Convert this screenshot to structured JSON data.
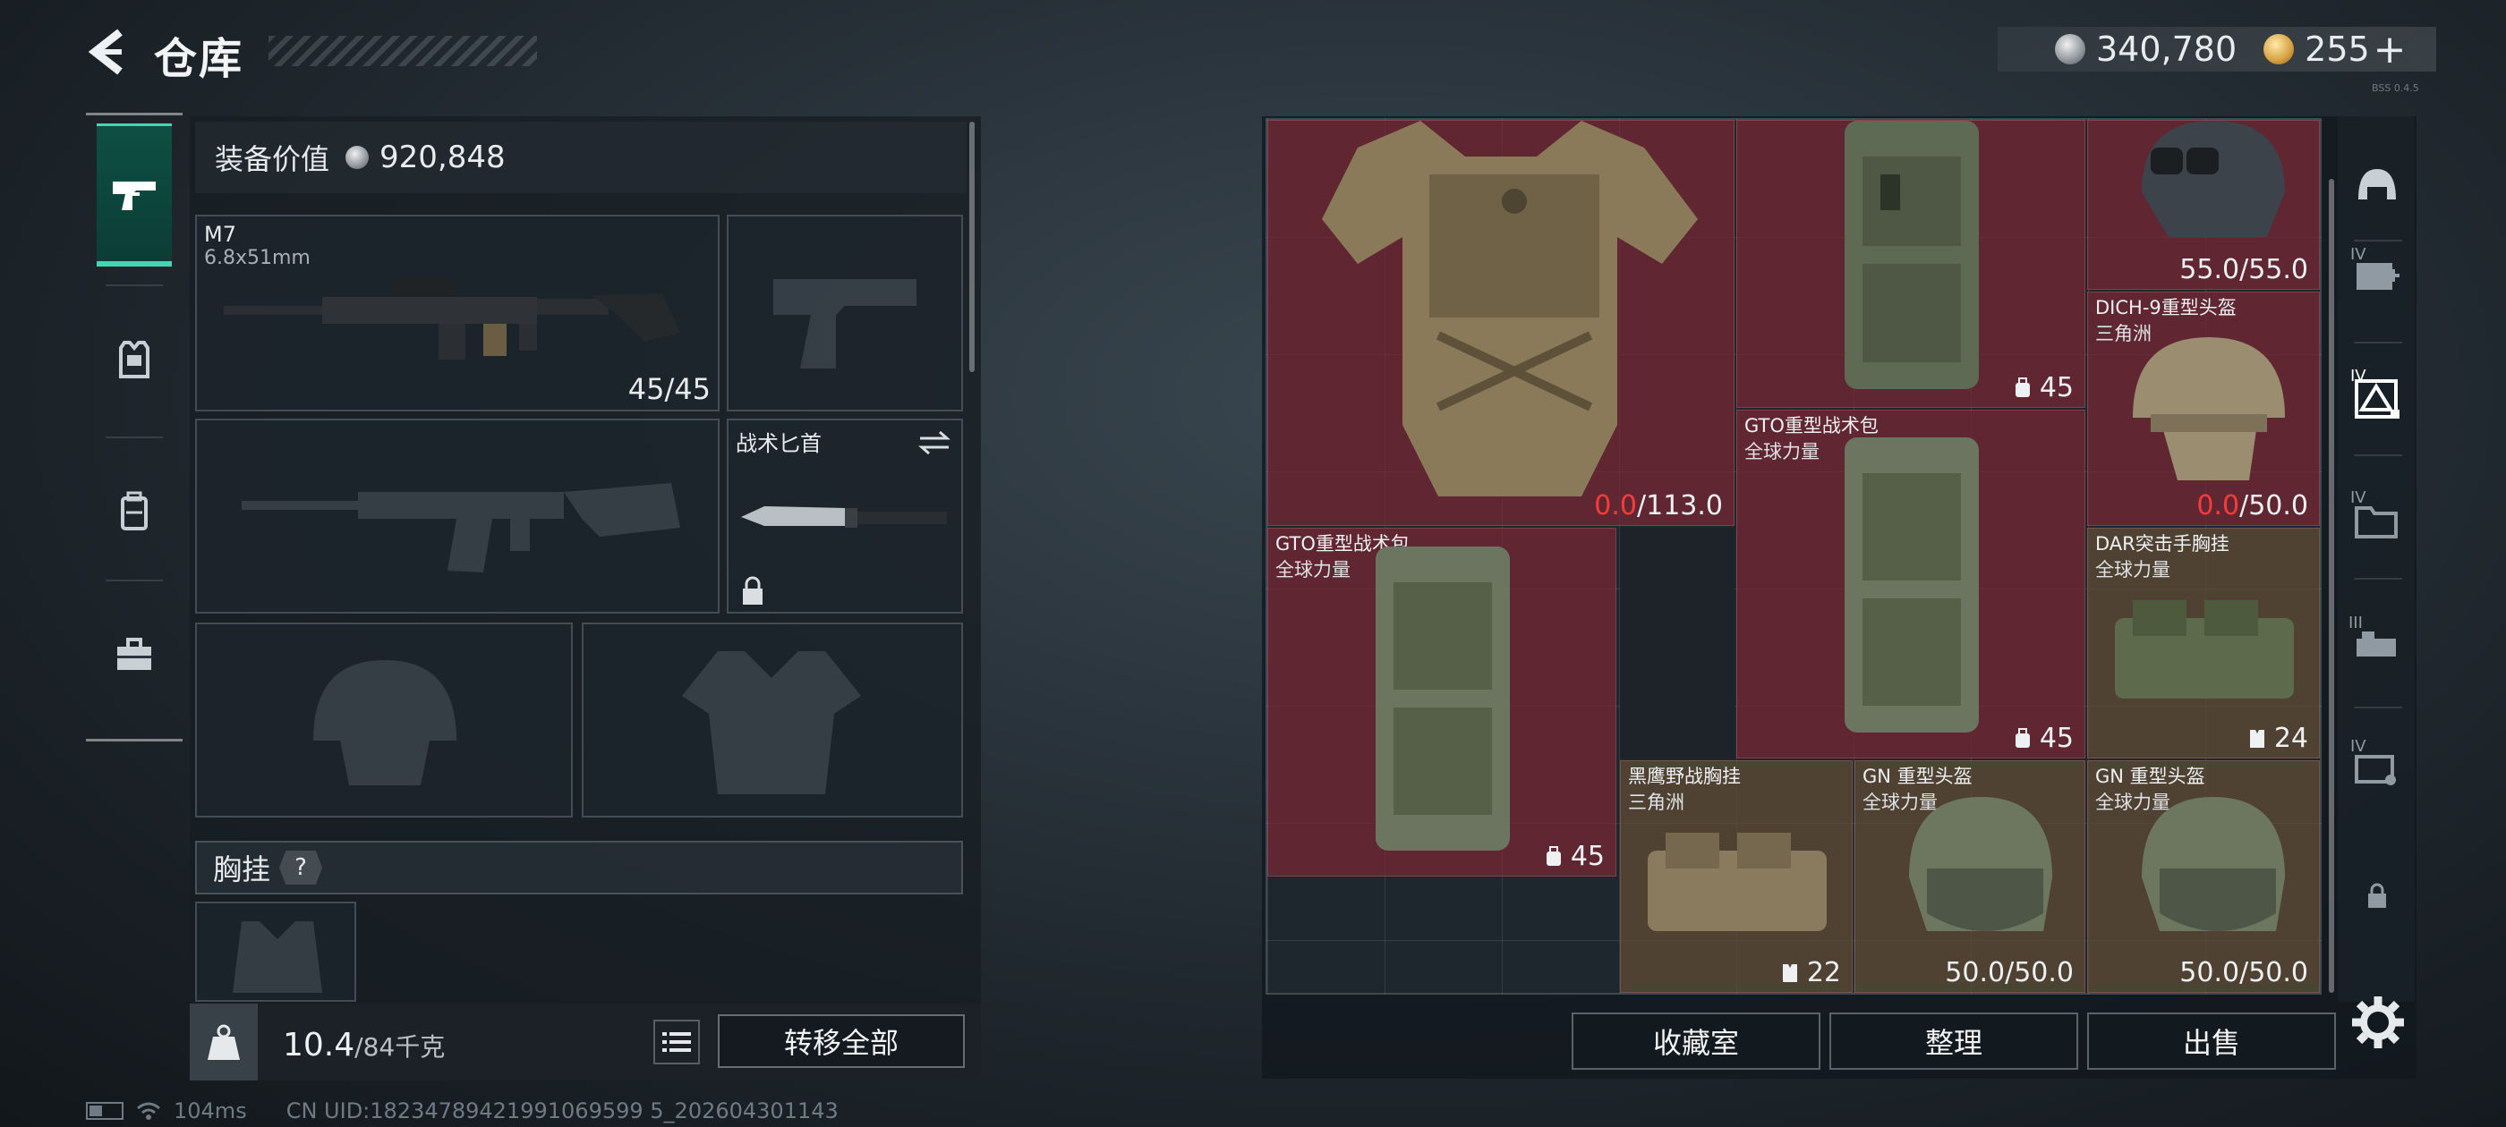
{
  "header": {
    "title": "仓库",
    "tiny_version": "BSS 0.4.5"
  },
  "currency": {
    "silver": "340,780",
    "gold": "255",
    "plus": "+"
  },
  "left_nav": {
    "items": [
      "weapons",
      "armor",
      "backpack",
      "toolbox"
    ]
  },
  "equipment": {
    "value_label": "装备价值",
    "value": "920,848",
    "primary": {
      "name": "M7",
      "caliber": "6.8x51mm",
      "ammo": "45/45"
    },
    "melee": {
      "name": "战术匕首"
    },
    "chest_rig_label": "胸挂",
    "help": "?"
  },
  "weight": {
    "current": "10.4",
    "max": "/84千克"
  },
  "transfer_all": "转移全部",
  "status": {
    "ping": "104ms",
    "uid": "CN UID:18234789421991069599 5_202604301143"
  },
  "inventory": {
    "armor": {
      "durability_current": "0.0",
      "durability_max": "/113.0"
    },
    "backpack_top": {
      "qty": "45"
    },
    "nvg_helmet": {
      "durability": "55.0/55.0"
    },
    "dich_helmet": {
      "name": "DICH-9重型头盔",
      "region": "三角洲",
      "durability_current": "0.0",
      "durability_max": "/50.0"
    },
    "gto_mid": {
      "name": "GTO重型战术包",
      "region": "全球力量",
      "qty": "45"
    },
    "gto_left": {
      "name": "GTO重型战术包",
      "region": "全球力量",
      "qty": "45"
    },
    "dar_rig": {
      "name": "DAR突击手胸挂",
      "region": "全球力量",
      "qty": "24"
    },
    "blackhawk_rig": {
      "name": "黑鹰野战胸挂",
      "region": "三角洲",
      "qty": "22"
    },
    "gn_helmet_1": {
      "name": "GN 重型头盔",
      "region": "全球力量",
      "durability": "50.0/50.0"
    },
    "gn_helmet_2": {
      "name": "GN 重型头盔",
      "region": "全球力量",
      "durability": "50.0/50.0"
    }
  },
  "inv_tabs": {
    "tier_iv": "IV",
    "tier_iii": "III"
  },
  "actions": {
    "collection": "收藏室",
    "sort": "整理",
    "sell": "出售"
  },
  "colors": {
    "accent": "#43d6b3",
    "red_bg": "#7a2834",
    "brown_bg": "#604c36",
    "durability_red": "#ff3b3b"
  }
}
